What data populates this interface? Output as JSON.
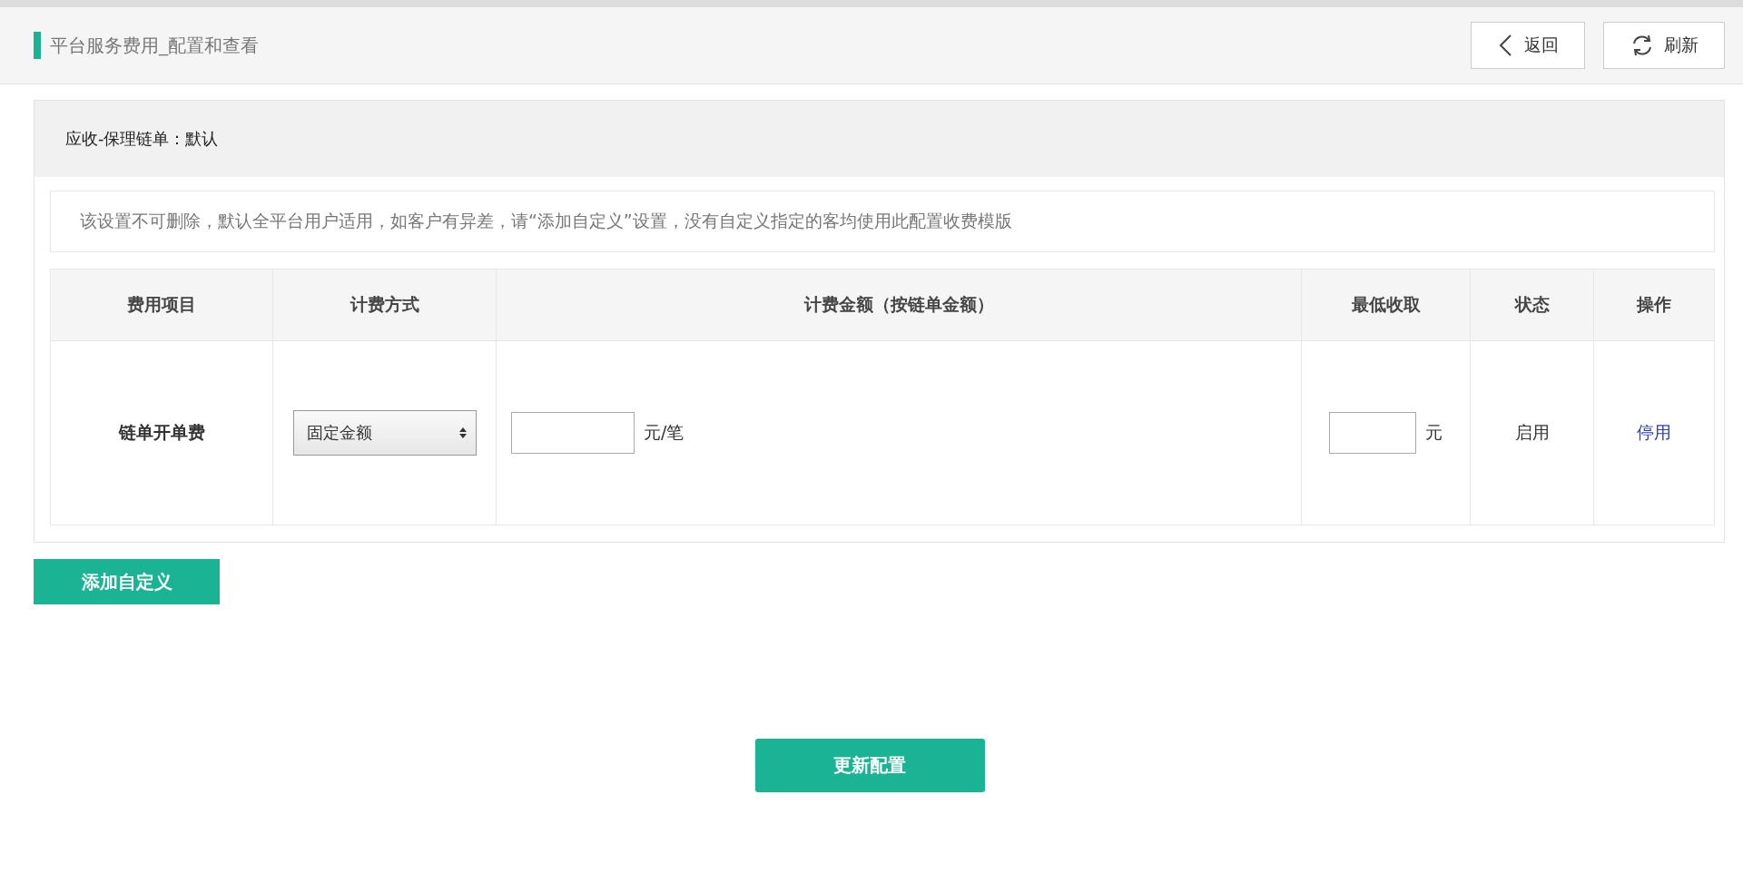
{
  "page_title": "平台服务费用_配置和查看",
  "header_buttons": [
    {
      "kind": "back",
      "label": "返回"
    },
    {
      "kind": "refresh",
      "label": "刷新"
    }
  ],
  "section": {
    "title": "应收-保理链单：默认",
    "notice": "该设置不可删除，默认全平台用户适用，如客户有异差，请“添加自定义”设置，没有自定义指定的客均使用此配置收费模版",
    "table": {
      "columns": [
        "费用项目",
        "计费方式",
        "计费金额（按链单金额）",
        "最低收取",
        "状态",
        "操作"
      ],
      "rows": [
        {
          "item": "链单开单费",
          "method": "固定金额",
          "amount_unit": "元/笔",
          "min_unit": "元",
          "status": "启用",
          "action": "停用"
        }
      ]
    }
  },
  "add_button": "添加自定义",
  "submit_button": "更新配置"
}
